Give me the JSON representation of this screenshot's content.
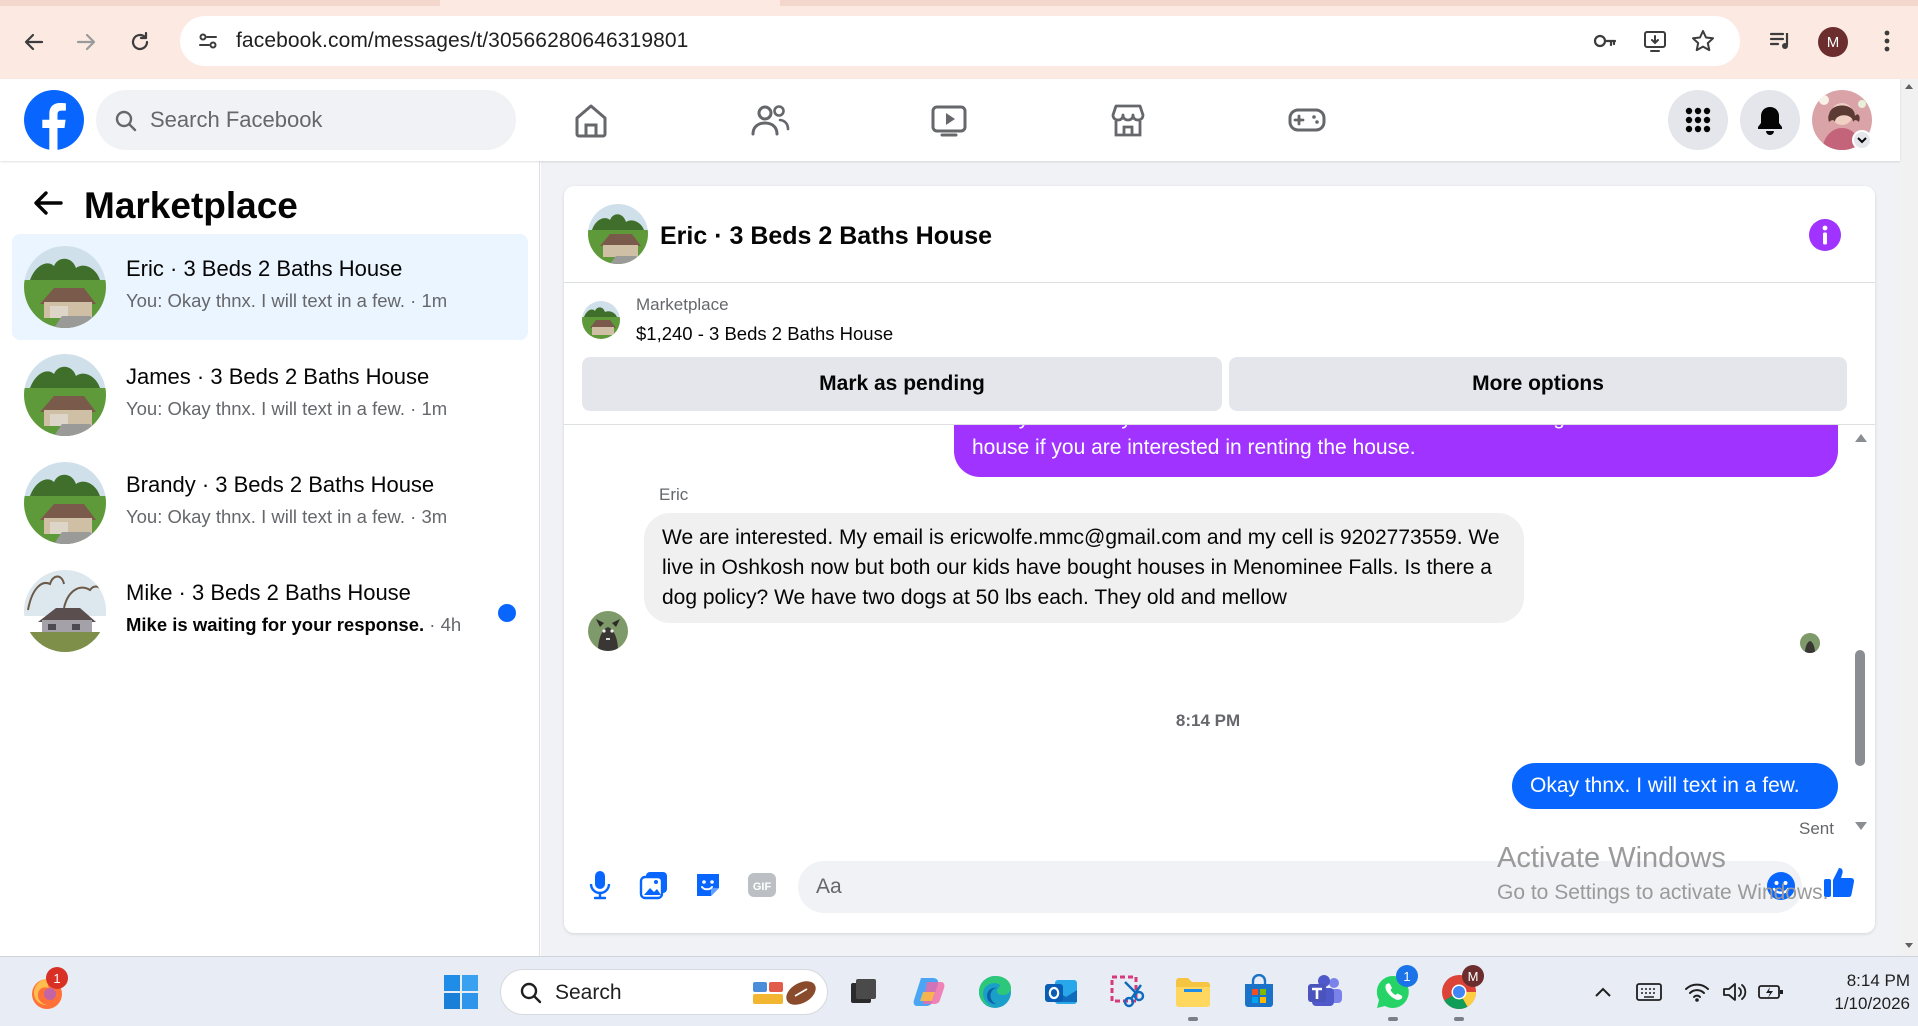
{
  "browser": {
    "url": "facebook.com/messages/t/30566280646319801",
    "profile_initial": "M"
  },
  "fb_header": {
    "search_placeholder": "Search Facebook",
    "nav_icons": [
      "home-icon",
      "friends-icon",
      "video-icon",
      "marketplace-icon",
      "gaming-icon"
    ],
    "right_icons": [
      "menu-grid-icon",
      "notifications-bell-icon"
    ]
  },
  "sidebar": {
    "title": "Marketplace",
    "conversations": [
      {
        "name": "Eric · 3 Beds 2 Baths House",
        "preview": "You: Okay thnx. I will text in a few.",
        "time": "· 1m",
        "active": true,
        "unread": false
      },
      {
        "name": "James · 3 Beds 2 Baths House",
        "preview": "You: Okay thnx. I will text in a few.",
        "time": "· 1m",
        "active": false,
        "unread": false
      },
      {
        "name": "Brandy · 3 Beds 2 Baths House",
        "preview": "You: Okay thnx. I will text in a few.",
        "time": "· 3m",
        "active": false,
        "unread": false
      },
      {
        "name": "Mike · 3 Beds 2 Baths House",
        "preview": "Mike is waiting for your response.",
        "time": "· 4h",
        "active": false,
        "unread": true
      }
    ]
  },
  "chat": {
    "title": "Eric · 3 Beds 2 Baths House",
    "listing": {
      "source": "Marketplace",
      "title": "$1,240 - 3 Beds 2 Baths House",
      "mark_pending_label": "Mark as pending",
      "more_options_label": "More options"
    },
    "messages": {
      "outgoing_partial": "Kindly send me your contact number for more information and get all the details about the house if you are interested in renting the house.",
      "incoming_sender": "Eric",
      "incoming_text": "We are interested. My email is ericwolfe.mmc@gmail.com and my cell is 9202773559. We live in Oshkosh now but both our kids have bought houses in Menominee Falls. Is there a dog policy? We have two dogs at 50 lbs each. They old and mellow",
      "timestamp": "8:14 PM",
      "outgoing_last": "Okay thnx. I will text in a few.",
      "status": "Sent"
    },
    "composer": {
      "placeholder": "Aa",
      "gif_label": "GIF"
    }
  },
  "watermark": {
    "line1": "Activate Windows",
    "line2": "Go to Settings to activate Windows."
  },
  "taskbar": {
    "search_placeholder": "Search",
    "badge_firefox": "1",
    "badge_whatsapp": "1",
    "badge_chrome": "M",
    "clock_time": "8:14 PM",
    "clock_date": "1/10/2026"
  },
  "colors": {
    "fb_blue": "#0866ff",
    "outgoing_purple": "#a033ff",
    "active_conv": "#ebf5ff",
    "chrome_bg": "#fbe9e2"
  }
}
